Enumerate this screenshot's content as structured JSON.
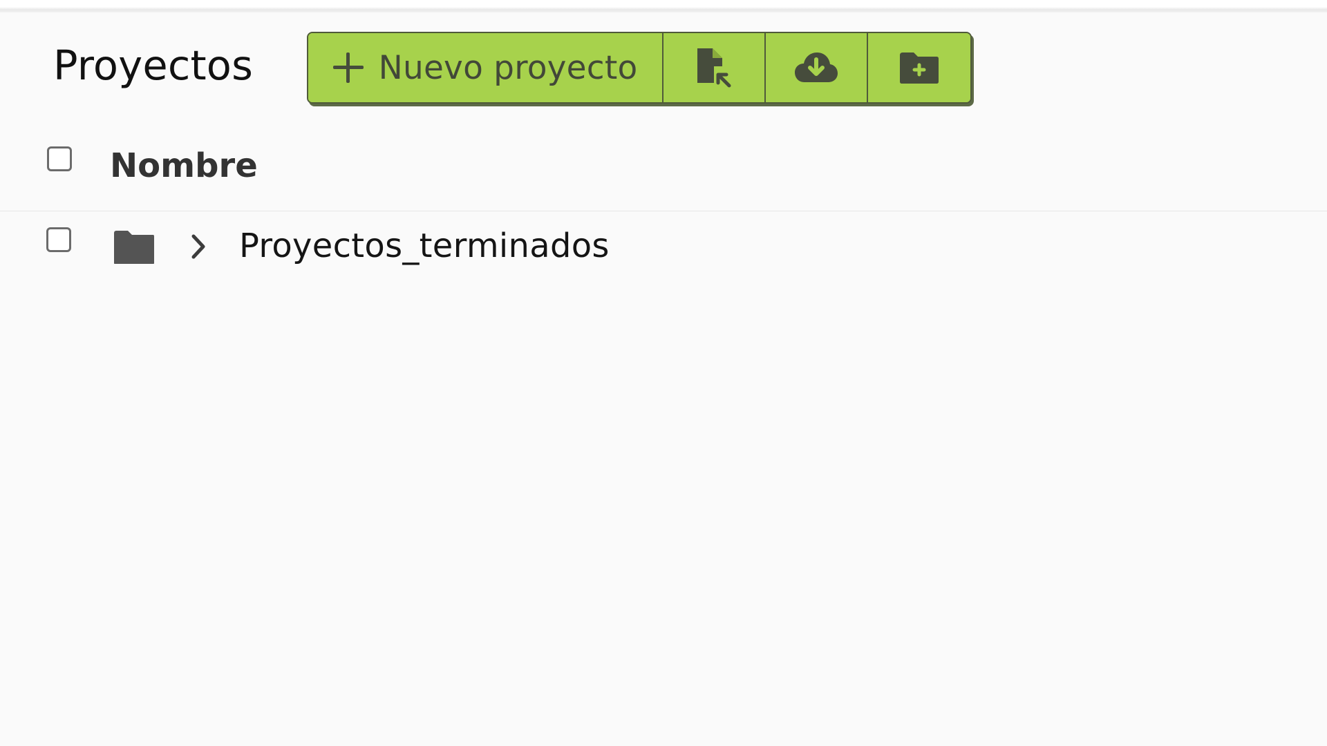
{
  "header": {
    "title": "Proyectos"
  },
  "toolbar": {
    "new_project_label": "Nuevo proyecto",
    "icons": [
      "plus-icon",
      "file-import-icon",
      "cloud-download-icon",
      "folder-plus-icon"
    ],
    "accent_color": "#a7d24c"
  },
  "list": {
    "column_header": "Nombre",
    "rows": [
      {
        "name": "Proyectos_terminados",
        "type": "folder",
        "expanded": false,
        "checked": false
      }
    ],
    "select_all_checked": false
  }
}
